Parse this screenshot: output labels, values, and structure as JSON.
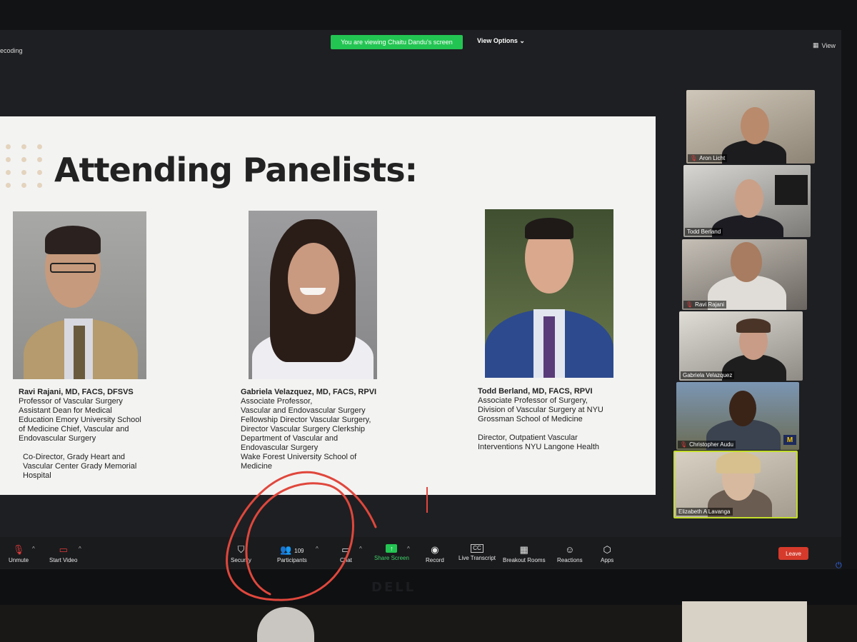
{
  "top_bar": {
    "left_text": "ecoding",
    "share_banner": "You are viewing Chaitu Dandu's screen",
    "view_options": "View Options ⌄",
    "view_button": "View"
  },
  "slide": {
    "title": "Attending Panelists:",
    "panelists": [
      {
        "name": "Ravi Rajani, MD, FACS, DFSVS",
        "lines": [
          "Professor of Vascular Surgery",
          "Assistant Dean for Medical",
          "Education Emory University School",
          "of Medicine Chief, Vascular and",
          "Endovascular Surgery"
        ],
        "lines2": [
          "Co-Director, Grady Heart and",
          "Vascular Center Grady Memorial",
          "Hospital"
        ]
      },
      {
        "name": "Gabriela Velazquez, MD, FACS, RPVI",
        "lines": [
          "Associate Professor,",
          "Vascular and Endovascular Surgery",
          "Fellowship Director Vascular Surgery,",
          "Director Vascular Surgery Clerkship",
          "Department of Vascular and",
          "Endovascular Surgery",
          "Wake Forest University School of",
          "Medicine"
        ]
      },
      {
        "name": "Todd Berland, MD, FACS, RPVI",
        "lines": [
          "Associate Professor of Surgery,",
          "Division of Vascular Surgery at NYU",
          "Grossman School of Medicine"
        ],
        "lines2": [
          "Director, Outpatient Vascular",
          "Interventions NYU Langone Health"
        ]
      }
    ]
  },
  "gallery": [
    {
      "name": "Aron Licht",
      "muted": true
    },
    {
      "name": "Todd Berland",
      "muted": false
    },
    {
      "name": "Ravi Rajani",
      "muted": true
    },
    {
      "name": "Gabriela Velazquez",
      "muted": false
    },
    {
      "name": "Christopher Audu",
      "muted": true
    },
    {
      "name": "Elizabeth A Lavanga",
      "muted": false
    }
  ],
  "toolbar": {
    "unmute": "Unmute",
    "start_video": "Start Video",
    "security": "Security",
    "participants": "Participants",
    "participants_count": "109",
    "chat": "Chat",
    "share_screen": "Share Screen",
    "record": "Record",
    "live_transcript": "Live Transcript",
    "breakout_rooms": "Breakout Rooms",
    "reactions": "Reactions",
    "apps": "Apps",
    "leave": "Leave",
    "cc_badge": "CC"
  },
  "monitor": {
    "brand": "DELL"
  },
  "colors": {
    "share_green": "#23c552",
    "leave_red": "#d63a2b",
    "annotation_red": "#e0473c",
    "active_speaker_border": "#c4de2c"
  }
}
